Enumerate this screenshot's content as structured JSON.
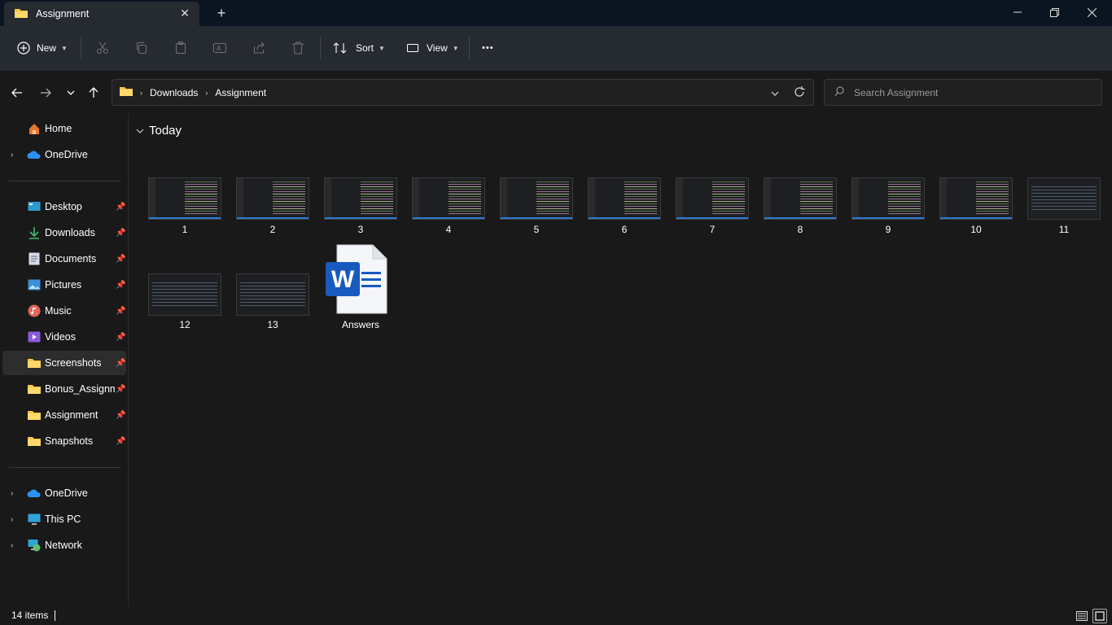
{
  "window": {
    "tab_title": "Assignment",
    "tab_close": "✕",
    "new_tab": "+"
  },
  "toolbar": {
    "new_label": "New",
    "sort_label": "Sort",
    "view_label": "View",
    "more": "•••"
  },
  "address": {
    "crumbs": [
      "Downloads",
      "Assignment"
    ],
    "search_placeholder": "Search Assignment"
  },
  "sidebar": {
    "top": [
      {
        "label": "Home",
        "icon": "home-icon"
      },
      {
        "label": "OneDrive",
        "icon": "cloud-icon"
      }
    ],
    "pinned": [
      {
        "label": "Desktop",
        "icon": "desktop-icon"
      },
      {
        "label": "Downloads",
        "icon": "download-icon"
      },
      {
        "label": "Documents",
        "icon": "document-icon"
      },
      {
        "label": "Pictures",
        "icon": "picture-icon"
      },
      {
        "label": "Music",
        "icon": "music-icon"
      },
      {
        "label": "Videos",
        "icon": "video-icon"
      },
      {
        "label": "Screenshots",
        "icon": "folder-icon"
      },
      {
        "label": "Bonus_Assignment",
        "icon": "folder-icon"
      },
      {
        "label": "Assignment",
        "icon": "folder-icon"
      },
      {
        "label": "Snapshots",
        "icon": "folder-icon"
      }
    ],
    "bottom": [
      {
        "label": "OneDrive",
        "icon": "cloud-icon"
      },
      {
        "label": "This PC",
        "icon": "pc-icon"
      },
      {
        "label": "Network",
        "icon": "network-icon"
      }
    ]
  },
  "main": {
    "group_title": "Today",
    "files": [
      {
        "name": "1"
      },
      {
        "name": "2"
      },
      {
        "name": "3"
      },
      {
        "name": "4"
      },
      {
        "name": "5"
      },
      {
        "name": "6"
      },
      {
        "name": "7"
      },
      {
        "name": "8"
      },
      {
        "name": "9"
      },
      {
        "name": "10"
      },
      {
        "name": "11"
      },
      {
        "name": "12"
      },
      {
        "name": "13"
      },
      {
        "name": "Answers"
      }
    ]
  },
  "status": {
    "item_count": "14 items"
  },
  "colors": {
    "accent": "#2d7bd6",
    "folder": "#f8c545",
    "word_blue": "#185abd"
  }
}
